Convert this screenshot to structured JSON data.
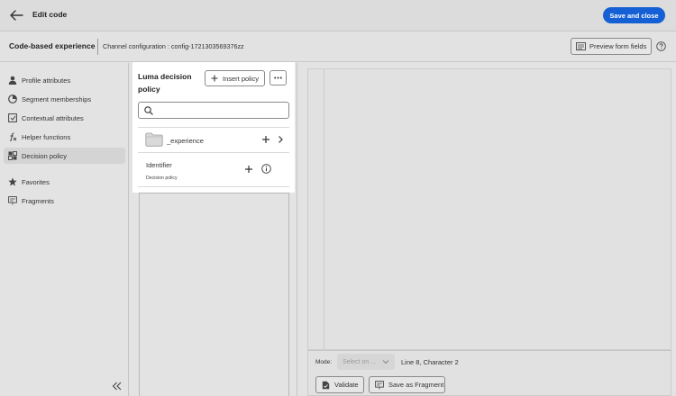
{
  "header": {
    "title": "Edit code",
    "save_close_label": "Save and close",
    "accent_color": "#1560d4"
  },
  "subheader": {
    "title": "Code-based experience",
    "channel_config": "Channel configuration : config-1721303569376zz",
    "preview_label": "Preview form fields"
  },
  "sidebar": {
    "items": [
      {
        "label": "Profile attributes",
        "icon": "person-icon"
      },
      {
        "label": "Segment memberships",
        "icon": "segment-icon"
      },
      {
        "label": "Contextual attributes",
        "icon": "contextual-icon"
      },
      {
        "label": "Helper functions",
        "icon": "function-icon"
      },
      {
        "label": "Decision policy",
        "icon": "decision-icon",
        "active": true
      },
      {
        "label": "Favorites",
        "icon": "star-icon"
      },
      {
        "label": "Fragments",
        "icon": "fragment-icon"
      }
    ]
  },
  "policy_panel": {
    "title": "Luma decision policy",
    "insert_label": "Insert policy",
    "search_placeholder": "",
    "folder": {
      "label": "_experience"
    },
    "item": {
      "name": "Identifier",
      "type": "Decision policy"
    }
  },
  "editor": {
    "mode_label": "Mode:",
    "mode_placeholder": "Select on ...",
    "cursor_position": "Line 8, Character 2",
    "validate_label": "Validate",
    "save_fragment_label": "Save as Fragment"
  }
}
